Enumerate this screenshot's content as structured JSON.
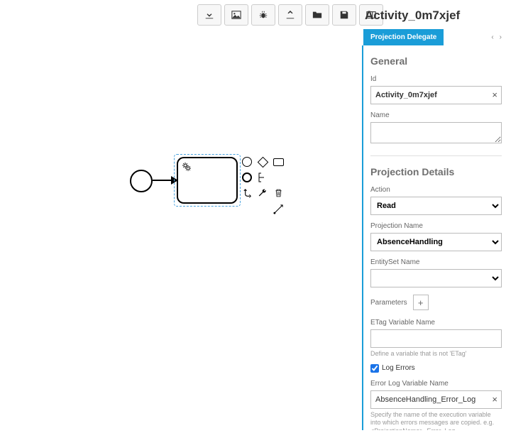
{
  "toolbar": {
    "items": [
      "download-icon",
      "image-icon",
      "bug-icon",
      "upload-icon",
      "folder-icon",
      "save-icon",
      "panel-icon"
    ]
  },
  "canvas": {
    "task_label": ""
  },
  "panel": {
    "title": "Activity_0m7xjef",
    "tab": "Projection Delegate",
    "general": {
      "heading": "General",
      "id_label": "Id",
      "id_value": "Activity_0m7xjef",
      "name_label": "Name",
      "name_value": ""
    },
    "details": {
      "heading": "Projection Details",
      "action_label": "Action",
      "action_value": "Read",
      "projname_label": "Projection Name",
      "projname_value": "AbsenceHandling",
      "entityset_label": "EntitySet Name",
      "entityset_value": "",
      "parameters_label": "Parameters",
      "etag_label": "ETag Variable Name",
      "etag_value": "",
      "etag_help": "Define a variable that is not 'ETag'",
      "logerrors_label": "Log Errors",
      "logerrors_checked": true,
      "errorlog_label": "Error Log Variable Name",
      "errorlog_value": "AbsenceHandling_Error_Log",
      "errorlog_help": "Specify the name of the execution variable into which errors messages are copied. e.g. <ProjectionName>_Error_Log"
    }
  }
}
